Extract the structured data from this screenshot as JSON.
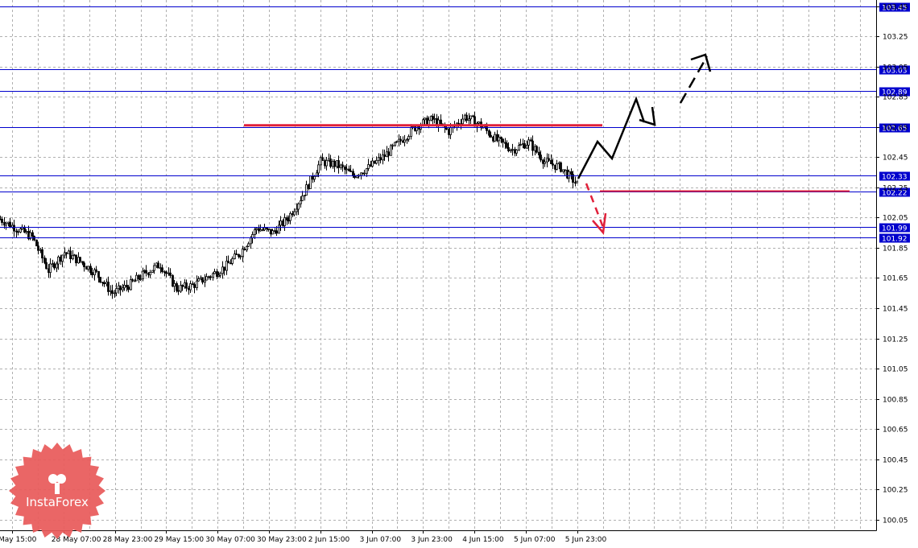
{
  "chart_data": {
    "type": "candlestick",
    "title": "",
    "xlabel": "",
    "ylabel": "",
    "ylim": [
      99.98,
      103.49
    ],
    "grid": true,
    "y_ticks": [
      "103.45",
      "103.25",
      "103.05",
      "102.85",
      "102.65",
      "102.45",
      "102.25",
      "102.05",
      "101.85",
      "101.65",
      "101.45",
      "101.25",
      "101.05",
      "100.85",
      "100.65",
      "100.45",
      "100.25",
      "100.05"
    ],
    "x_ticks": [
      "May 15:00",
      "28 May 07:00",
      "28 May 23:00",
      "29 May 15:00",
      "30 May 07:00",
      "30 May 23:00",
      "2 Jun 15:00",
      "3 Jun 07:00",
      "3 Jun 23:00",
      "4 Jun 15:00",
      "5 Jun 07:00",
      "5 Jun 23:00"
    ],
    "price_levels": [
      {
        "label": "103.45",
        "value": 103.45
      },
      {
        "label": "103.03",
        "value": 103.03
      },
      {
        "label": "102.89",
        "value": 102.89
      },
      {
        "label": "102.65",
        "value": 102.65
      },
      {
        "label": "102.33",
        "value": 102.33
      },
      {
        "label": "102.22",
        "value": 102.22
      },
      {
        "label": "101.99",
        "value": 101.99
      },
      {
        "label": "101.92",
        "value": 101.92
      }
    ],
    "close_path": [
      {
        "x": 0,
        "y": 102.04
      },
      {
        "x": 8,
        "y": 101.98
      },
      {
        "x": 16,
        "y": 101.92
      },
      {
        "x": 24,
        "y": 101.7
      },
      {
        "x": 32,
        "y": 101.82
      },
      {
        "x": 40,
        "y": 101.76
      },
      {
        "x": 48,
        "y": 101.68
      },
      {
        "x": 56,
        "y": 101.55
      },
      {
        "x": 64,
        "y": 101.6
      },
      {
        "x": 72,
        "y": 101.68
      },
      {
        "x": 80,
        "y": 101.74
      },
      {
        "x": 88,
        "y": 101.58
      },
      {
        "x": 96,
        "y": 101.6
      },
      {
        "x": 104,
        "y": 101.66
      },
      {
        "x": 112,
        "y": 101.72
      },
      {
        "x": 120,
        "y": 101.82
      },
      {
        "x": 128,
        "y": 101.98
      },
      {
        "x": 136,
        "y": 101.95
      },
      {
        "x": 144,
        "y": 102.05
      },
      {
        "x": 152,
        "y": 102.22
      },
      {
        "x": 160,
        "y": 102.42
      },
      {
        "x": 168,
        "y": 102.4
      },
      {
        "x": 176,
        "y": 102.33
      },
      {
        "x": 184,
        "y": 102.38
      },
      {
        "x": 192,
        "y": 102.46
      },
      {
        "x": 200,
        "y": 102.56
      },
      {
        "x": 208,
        "y": 102.66
      },
      {
        "x": 216,
        "y": 102.7
      },
      {
        "x": 224,
        "y": 102.62
      },
      {
        "x": 232,
        "y": 102.72
      },
      {
        "x": 240,
        "y": 102.66
      },
      {
        "x": 248,
        "y": 102.56
      },
      {
        "x": 256,
        "y": 102.5
      },
      {
        "x": 264,
        "y": 102.55
      },
      {
        "x": 272,
        "y": 102.42
      },
      {
        "x": 280,
        "y": 102.38
      },
      {
        "x": 288,
        "y": 102.27
      }
    ],
    "resistance_line": {
      "value": 102.65
    },
    "support_line": {
      "value": 102.22
    }
  },
  "logo": {
    "text": "InstaForex"
  },
  "colors": {
    "level": "#0000cd",
    "red": "#e0203a",
    "grid": "#b0b0b0",
    "candle": "#000000"
  }
}
